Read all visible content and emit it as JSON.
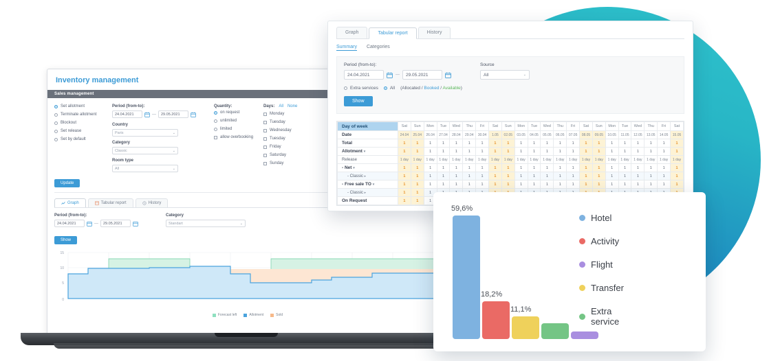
{
  "inventory": {
    "title": "Inventory management",
    "subbar": "Sales management",
    "radios": [
      {
        "label": "Set allotment",
        "checked": true
      },
      {
        "label": "Terminate allotment",
        "checked": false
      },
      {
        "label": "Blockout",
        "checked": false
      },
      {
        "label": "Set release",
        "checked": false
      },
      {
        "label": "Set by default",
        "checked": false
      }
    ],
    "period_label": "Period (from-to):",
    "date_from": "24.04.2021",
    "date_to": "29.05.2021",
    "dash": "—",
    "country_label": "Country",
    "country_value": "Paris",
    "category_label": "Category",
    "category_value": "Classic",
    "roomtype_label": "Room type",
    "roomtype_value": "All",
    "quantity_label": "Quantity:",
    "quantity_options": [
      {
        "label": "on request",
        "checked": true
      },
      {
        "label": "unlimited",
        "checked": false
      },
      {
        "label": "limited",
        "checked": false
      }
    ],
    "overbooking_label": "allow overbooking",
    "days_label": "Days:",
    "days_all": "All",
    "days_none": "None",
    "days": [
      "Monday",
      "Tuesday",
      "Wednesday",
      "Tuesday",
      "Friday",
      "Saturday",
      "Sunday"
    ],
    "update_label": "Update"
  },
  "graph_panel": {
    "tabs": [
      {
        "label": "Graph",
        "active": true,
        "icon": "chart-icon"
      },
      {
        "label": "Tabular report",
        "active": false,
        "icon": "table-icon"
      },
      {
        "label": "History",
        "active": false,
        "icon": "clock-icon"
      }
    ],
    "period_label": "Period (from-to):",
    "date_from": "24.04.2021",
    "date_to": "29.05.2021",
    "dash": "—",
    "category_label": "Category",
    "category_value": "Standart",
    "show_label": "Show"
  },
  "area_chart": {
    "type": "area",
    "title": "",
    "xlabel": "",
    "ylabel": "",
    "ylim": [
      0,
      15
    ],
    "yticks": [
      0,
      5,
      10,
      15
    ],
    "grid": true,
    "legend_position": "bottom",
    "legend": [
      "Forecast left",
      "Allotment",
      "Sold"
    ],
    "colors": {
      "forecast_left": "#8fe0c0",
      "allotment": "#4aa3dd",
      "sold": "#f6b98a"
    },
    "series": [
      {
        "name": "Allotment",
        "values": [
          8,
          8,
          9.3,
          9.3,
          9.3,
          9.3,
          10.1,
          10.1,
          8.3,
          5.7,
          5.7,
          5.7,
          5.7,
          6.6,
          7.2,
          8.4,
          8.4,
          8.4
        ]
      },
      {
        "name": "Forecast left",
        "values": [
          0,
          0,
          13.2,
          13.2,
          13.2,
          0,
          0,
          0,
          0,
          0,
          13.2,
          13.2,
          13.2,
          13.2,
          13.2,
          13.2,
          13.2,
          13.2
        ]
      },
      {
        "name": "Sold",
        "values": [
          0,
          0,
          0,
          0,
          0,
          0,
          0,
          9.9,
          9.9,
          9.9,
          9.9,
          9.9,
          9.9,
          9.9,
          9.9,
          9.9,
          9.9,
          9.9
        ]
      }
    ]
  },
  "report": {
    "tabs": [
      {
        "label": "Graph",
        "active": false
      },
      {
        "label": "Tabular report",
        "active": true
      },
      {
        "label": "History",
        "active": false
      }
    ],
    "sublinks": [
      {
        "label": "Summary",
        "active": true
      },
      {
        "label": "Categories",
        "active": false
      }
    ],
    "period_label": "Period (from-to):",
    "date_from": "24.04.2021",
    "date_to": "29.05.2021",
    "dash": "—",
    "source_label": "Source",
    "source_value": "All",
    "radio_extra": "Extra services",
    "radio_all": "All",
    "legend_note_prefix": "(",
    "legend_allocated": "Allocated",
    "legend_sep1": " / ",
    "legend_booked": "Booked",
    "legend_sep2": " / ",
    "legend_available": "Available",
    "legend_note_suffix": ")",
    "show_label": "Show",
    "table": {
      "row_header_label": "Day of week",
      "weekdays": [
        "Sat",
        "Sun",
        "Mon",
        "Tue",
        "Wed",
        "Thu",
        "Fri",
        "Sat",
        "Sun",
        "Mon",
        "Tue",
        "Wed",
        "Thu",
        "Fri",
        "Sat",
        "Sun",
        "Mon",
        "Tue",
        "Wed",
        "Thu",
        "Fri",
        "Sat"
      ],
      "dates": [
        "24.04",
        "25.04",
        "26.04",
        "27.04",
        "28.04",
        "29.04",
        "30.04",
        "1.05",
        "02.05",
        "03.05",
        "04.05",
        "05.05",
        "06.05",
        "07.05",
        "08.05",
        "09.05",
        "10.05",
        "11.05",
        "12.05",
        "13.05",
        "14.05",
        "15.05"
      ],
      "weekend_index": [
        0,
        1,
        7,
        8,
        14,
        15,
        21
      ],
      "rows": [
        {
          "label": "Date",
          "kind": "date"
        },
        {
          "label": "Total",
          "kind": "num",
          "bold": true,
          "values": [
            "1",
            "1",
            "1",
            "1",
            "1",
            "1",
            "1",
            "1",
            "1",
            "1",
            "1",
            "1",
            "1",
            "1",
            "1",
            "1",
            "1",
            "1",
            "1",
            "1",
            "1",
            "1"
          ]
        },
        {
          "label": "Allotment",
          "kind": "num",
          "bold": true,
          "caret": "▾",
          "values": [
            "1",
            "1",
            "1",
            "1",
            "1",
            "1",
            "1",
            "1",
            "1",
            "1",
            "1",
            "1",
            "1",
            "1",
            "1",
            "1",
            "1",
            "1",
            "1",
            "1",
            "1",
            "1"
          ]
        },
        {
          "label": "Release",
          "kind": "rel",
          "bold": false,
          "values": [
            "1 day",
            "1 day",
            "1 day",
            "1 day",
            "1 day",
            "1 day",
            "1 day",
            "1 day",
            "1 day",
            "1 day",
            "1 day",
            "1 day",
            "1 day",
            "1 day",
            "1 day",
            "1 day",
            "1 day",
            "1 day",
            "1 day",
            "1 day",
            "1 day",
            "1 day"
          ]
        },
        {
          "label": "- Net",
          "kind": "num",
          "bold": true,
          "caret": "▾",
          "values": [
            "1",
            "1",
            "1",
            "1",
            "1",
            "1",
            "1",
            "1",
            "1",
            "1",
            "1",
            "1",
            "1",
            "1",
            "1",
            "1",
            "1",
            "1",
            "1",
            "1",
            "1",
            "1"
          ]
        },
        {
          "label": "- Classic",
          "kind": "num",
          "bold": false,
          "caret": "▸",
          "indent": true,
          "values": [
            "1",
            "1",
            "1",
            "1",
            "1",
            "1",
            "1",
            "1",
            "1",
            "1",
            "1",
            "1",
            "1",
            "1",
            "1",
            "1",
            "1",
            "1",
            "1",
            "1",
            "1",
            "1"
          ]
        },
        {
          "label": "- Free sale TO",
          "kind": "num",
          "bold": true,
          "caret": "▾",
          "values": [
            "1",
            "1",
            "1",
            "1",
            "1",
            "1",
            "1",
            "1",
            "1",
            "1",
            "1",
            "1",
            "1",
            "1",
            "1",
            "1",
            "1",
            "1",
            "1",
            "1",
            "1",
            "1"
          ]
        },
        {
          "label": "- Classic",
          "kind": "num",
          "bold": false,
          "caret": "▸",
          "indent": true,
          "values": [
            "1",
            "1",
            "1",
            "1",
            "1",
            "1",
            "1",
            "1",
            "1",
            "1",
            "1",
            "1",
            "1",
            "1",
            "1",
            "1",
            "1",
            "1",
            "1",
            "1",
            "1",
            "1"
          ]
        },
        {
          "label": "On Request",
          "kind": "num",
          "bold": true,
          "values": [
            "1",
            "1",
            "1",
            "1",
            "1",
            "1",
            "1",
            "1",
            "1",
            "1",
            "1",
            "1",
            "1",
            "1",
            "1",
            "1",
            "1",
            "1",
            "1",
            "1",
            "1",
            "1"
          ]
        }
      ]
    }
  },
  "chart_data": {
    "type": "bar",
    "title": "",
    "xlabel": "",
    "ylabel": "",
    "categories": [
      "Hotel",
      "Activity",
      "Transfer",
      "Extra service",
      "Flight"
    ],
    "values": [
      59.6,
      18.2,
      11.1,
      7.5,
      3.6
    ],
    "labels": [
      "59,6%",
      "18,2%",
      "11,1%",
      "",
      ""
    ],
    "ylim": [
      0,
      65
    ],
    "grid": false,
    "legend_position": "right",
    "colors": [
      "#7eb2e0",
      "#ea6a65",
      "#efd15b",
      "#74c585",
      "#a98ee0"
    ],
    "legend": [
      {
        "name": "Hotel",
        "color": "#7eb2e0"
      },
      {
        "name": "Activity",
        "color": "#ea6a65"
      },
      {
        "name": "Flight",
        "color": "#a98ee0"
      },
      {
        "name": "Transfer",
        "color": "#efd15b"
      },
      {
        "name": "Extra service",
        "color": "#74c585"
      }
    ]
  }
}
